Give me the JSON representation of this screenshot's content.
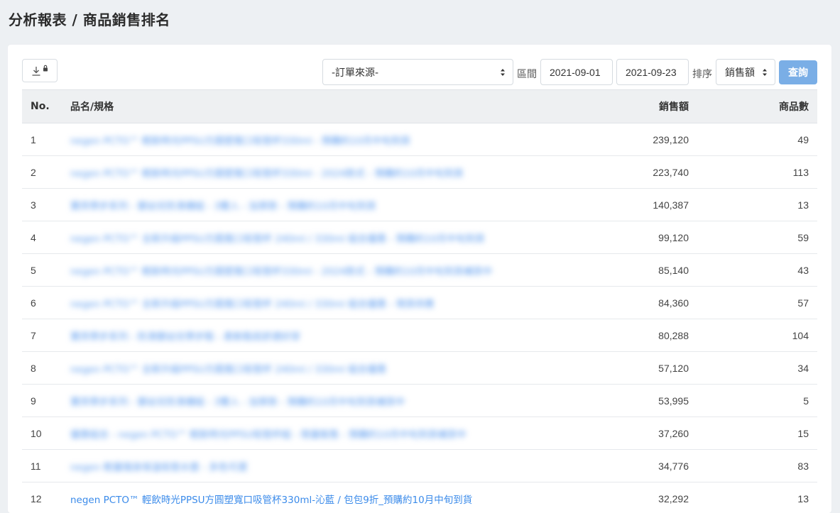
{
  "page": {
    "title": "分析報表 / 商品銷售排名"
  },
  "toolbar": {
    "download_icon": "download-icon",
    "lock_icon": "lock-icon",
    "source_select": "-訂單來源-",
    "range_label": "區間",
    "date_start": "2021-09-01",
    "date_end": "2021-09-23",
    "sort_label": "排序",
    "sort_select": "銷售額",
    "query_button": "查詢"
  },
  "table": {
    "columns": {
      "no": "No.",
      "name": "品名/規格",
      "sales": "銷售額",
      "count": "商品數"
    },
    "rows": [
      {
        "no": "1",
        "name": "negen PCTO™ 輕飲時光PPSU方圓塑寬口吸管杯330ml - 預購約10月中旬到貨",
        "sales": "239,120",
        "count": "49"
      },
      {
        "no": "2",
        "name": "negen PCTO™ 輕飲時光PPSU方圓塑寬口吸管杯330ml - 2024款式 - 預購約10月中旬到貨",
        "sales": "223,740",
        "count": "113"
      },
      {
        "no": "3",
        "name": "寶貝學步系列 - 嬰幼兒防滑襪組 - 3雙入 - 加厚款 - 預購約10月中旬到貨",
        "sales": "140,387",
        "count": "13"
      },
      {
        "no": "4",
        "name": "negen PCTO™ 全新升級PPSU方圓寬口吸管杯 240ml / 330ml 組合優惠 - 預購約10月中旬到貨",
        "sales": "99,120",
        "count": "59"
      },
      {
        "no": "5",
        "name": "negen PCTO™ 輕飲時光PPSU方圓塑寬口吸管杯330ml - 2024款式 - 預購約10月中旬到貨補貨中",
        "sales": "85,140",
        "count": "43"
      },
      {
        "no": "6",
        "name": "negen PCTO™ 全新升級PPSU方圓寬口吸管杯 240ml / 330ml 組合優惠 - 現貨供應",
        "sales": "84,360",
        "count": "57"
      },
      {
        "no": "7",
        "name": "寶貝學步系列 - 防滑嬰幼兒學步鞋 - 柔軟鞋底舒適好穿",
        "sales": "80,288",
        "count": "104"
      },
      {
        "no": "8",
        "name": "negen PCTO™ 全新升級PPSU方圓寬口吸管杯 240ml / 330ml 組合優惠",
        "sales": "57,120",
        "count": "34"
      },
      {
        "no": "9",
        "name": "寶貝學步系列 - 嬰幼兒防滑襪組 - 3雙入 - 加厚款 - 預購約10月中旬到貨補貨中",
        "sales": "53,995",
        "count": "5"
      },
      {
        "no": "10",
        "name": "優惠組合 - negen PCTO™ 輕飲時光PPSU吸管杯組 - 限量販售 - 預購約10月中旬到貨補貨中",
        "sales": "37,260",
        "count": "15"
      },
      {
        "no": "11",
        "name": "negen 輕量隨身保溫吸管水壺 - 多色可選",
        "sales": "34,776",
        "count": "83"
      },
      {
        "no": "12",
        "name": "negen PCTO™ 輕飲時光PPSU方圓塑寬口吸管杯330ml-沁藍 / 包包9折_預購約10月中旬到貨",
        "sales": "32,292",
        "count": "13"
      }
    ]
  },
  "colors": {
    "link": "#3b8bea",
    "primary_button": "#7aaee6",
    "header_bg": "#eef0f2",
    "page_bg": "#edf0f3"
  }
}
